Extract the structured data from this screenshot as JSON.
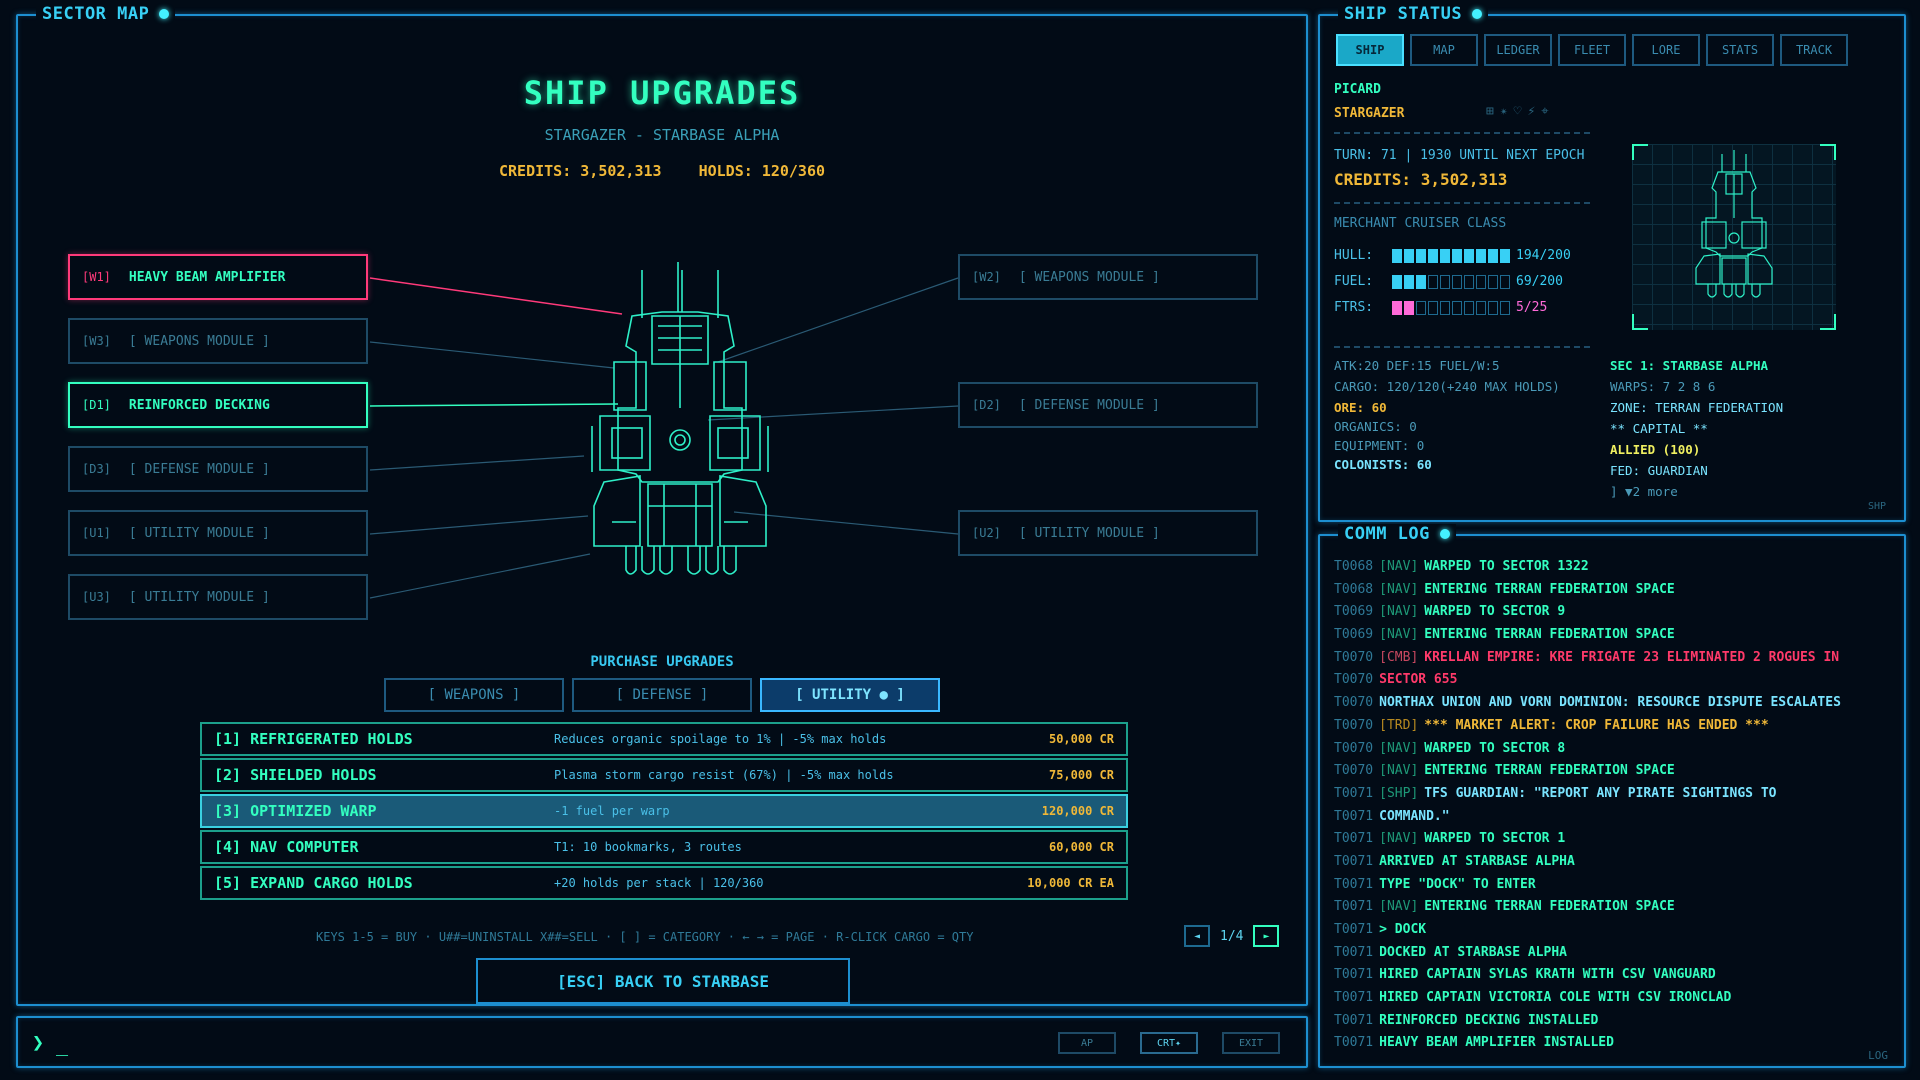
{
  "sector": {
    "frame_title": "SECTOR MAP",
    "title": "SHIP UPGRADES",
    "subtitle": "STARGAZER - STARBASE ALPHA",
    "credits": "CREDITS: 3,502,313",
    "holds": "HOLDS: 120/360",
    "slots": [
      {
        "code": "[W1]",
        "name": "HEAVY BEAM AMPLIFIER",
        "state": "installed-red"
      },
      {
        "code": "[W3]",
        "name": "[ WEAPONS MODULE ]",
        "state": "empty"
      },
      {
        "code": "[D1]",
        "name": "REINFORCED DECKING",
        "state": "installed-green"
      },
      {
        "code": "[D3]",
        "name": "[ DEFENSE MODULE ]",
        "state": "empty"
      },
      {
        "code": "[U1]",
        "name": "[ UTILITY MODULE ]",
        "state": "empty"
      },
      {
        "code": "[U3]",
        "name": "[ UTILITY MODULE ]",
        "state": "empty"
      },
      {
        "code": "[W2]",
        "name": "[ WEAPONS MODULE ]",
        "state": "empty"
      },
      {
        "code": "[D2]",
        "name": "[ DEFENSE MODULE ]",
        "state": "empty"
      },
      {
        "code": "[U2]",
        "name": "[ UTILITY MODULE ]",
        "state": "empty"
      }
    ],
    "purchase_title": "PURCHASE UPGRADES",
    "categories": [
      "[ WEAPONS ]",
      "[ DEFENSE ]",
      "[ UTILITY ● ]"
    ],
    "selected_category": 2,
    "items": [
      {
        "name": "[1] REFRIGERATED HOLDS",
        "desc": "Reduces organic spoilage to 1% | -5% max holds",
        "price": "50,000 CR"
      },
      {
        "name": "[2] SHIELDED HOLDS",
        "desc": "Plasma storm cargo resist (67%) | -5% max holds",
        "price": "75,000 CR"
      },
      {
        "name": "[3] OPTIMIZED WARP",
        "desc": "-1 fuel per warp",
        "price": "120,000 CR"
      },
      {
        "name": "[4] NAV COMPUTER",
        "desc": "T1: 10 bookmarks, 3 routes",
        "price": "60,000 CR"
      },
      {
        "name": "[5] EXPAND CARGO HOLDS",
        "desc": "+20 holds per stack | 120/360",
        "price": "10,000 CR EA"
      }
    ],
    "keys_hint": "KEYS 1-5 = BUY  ·  U##=UNINSTALL X##=SELL  ·  [ ] = CATEGORY  ·  ← → = PAGE  ·  R-CLICK CARGO = QTY",
    "page": "1/4",
    "prev_label": "◄",
    "next_label": "►",
    "back_button": "[ESC] BACK TO STARBASE"
  },
  "cmdbar": {
    "prompt": "❯",
    "cursor": "_",
    "buttons": [
      "AP",
      "CRT✦",
      "EXIT"
    ]
  },
  "status": {
    "frame_title": "SHIP STATUS",
    "tabs": [
      "SHIP",
      "MAP",
      "LEDGER",
      "FLEET",
      "LORE",
      "STATS",
      "TRACK"
    ],
    "selected_tab": 0,
    "pilot": "PICARD",
    "ship": "STARGAZER",
    "icons": "⊞✴♡⚡⌖",
    "turn": "TURN: 71 | 1930 UNTIL NEXT EPOCH",
    "credits": "CREDITS: 3,502,313",
    "ship_class": "MERCHANT CRUISER CLASS",
    "hull": {
      "label": "HULL:",
      "value": "194/200",
      "level": 0.97
    },
    "fuel": {
      "label": "FUEL:",
      "value": "69/200",
      "level": 0.345
    },
    "ftrs": {
      "label": "FTRS:",
      "value": "5/25",
      "level": 0.2
    },
    "combat": "ATK:20 DEF:15 FUEL/W:5",
    "cargo": "CARGO: 120/120(+240 MAX HOLDS)",
    "ore": "ORE: 60",
    "organics": "ORGANICS: 0",
    "equipment": "EQUIPMENT: 0",
    "colonists": "COLONISTS: 60",
    "sector_name": "SEC 1: STARBASE ALPHA",
    "warps": "WARPS: 7 2 8 6",
    "zone": "ZONE: TERRAN FEDERATION",
    "capital": "** CAPITAL **",
    "allied": "ALLIED (100)",
    "fed": "FED: GUARDIAN",
    "more": "] ▼2 more",
    "tag": "SHP"
  },
  "log": {
    "frame_title": "COMM LOG",
    "tag": "LOG",
    "lines": [
      {
        "t": "T0068",
        "tag": "[NAV]",
        "msg": "WARPED TO SECTOR 1322",
        "kind": "nav"
      },
      {
        "t": "T0068",
        "tag": "[NAV]",
        "msg": "ENTERING TERRAN FEDERATION SPACE",
        "kind": "nav"
      },
      {
        "t": "T0069",
        "tag": "[NAV]",
        "msg": "WARPED TO SECTOR 9",
        "kind": "nav"
      },
      {
        "t": "T0069",
        "tag": "[NAV]",
        "msg": "ENTERING TERRAN FEDERATION SPACE",
        "kind": "nav"
      },
      {
        "t": "T0070",
        "tag": "[CMB]",
        "msg": "KRELLAN EMPIRE: KRE FRIGATE 23 ELIMINATED 2 ROGUES IN",
        "kind": "cmb"
      },
      {
        "t": "T0070",
        "tag": "",
        "msg": "SECTOR 655",
        "kind": "cmb"
      },
      {
        "t": "T0070",
        "tag": "",
        "msg": "NORTHAX UNION AND VORN DOMINION: RESOURCE DISPUTE ESCALATES",
        "kind": "cyan"
      },
      {
        "t": "T0070",
        "tag": "[TRD]",
        "msg": "*** MARKET ALERT: CROP FAILURE HAS ENDED ***",
        "kind": "trd"
      },
      {
        "t": "T0070",
        "tag": "[NAV]",
        "msg": "WARPED TO SECTOR 8",
        "kind": "nav"
      },
      {
        "t": "T0070",
        "tag": "[NAV]",
        "msg": "ENTERING TERRAN FEDERATION SPACE",
        "kind": "nav"
      },
      {
        "t": "T0071",
        "tag": "[SHP]",
        "msg": "TFS GUARDIAN: \"REPORT ANY PIRATE SIGHTINGS TO",
        "kind": "shp"
      },
      {
        "t": "T0071",
        "tag": "",
        "msg": "COMMAND.\"",
        "kind": "shp"
      },
      {
        "t": "T0071",
        "tag": "[NAV]",
        "msg": "WARPED TO SECTOR 1",
        "kind": "nav"
      },
      {
        "t": "T0071",
        "tag": "",
        "msg": "ARRIVED AT STARBASE ALPHA",
        "kind": "nav"
      },
      {
        "t": "T0071",
        "tag": "",
        "msg": "TYPE \"DOCK\" TO ENTER",
        "kind": "nav"
      },
      {
        "t": "T0071",
        "tag": "[NAV]",
        "msg": "ENTERING TERRAN FEDERATION SPACE",
        "kind": "nav"
      },
      {
        "t": "T0071",
        "tag": "",
        "msg": "> DOCK",
        "kind": "nav"
      },
      {
        "t": "T0071",
        "tag": "",
        "msg": "DOCKED AT STARBASE ALPHA",
        "kind": "nav"
      },
      {
        "t": "T0071",
        "tag": "",
        "msg": "HIRED CAPTAIN SYLAS KRATH WITH CSV VANGUARD",
        "kind": "nav"
      },
      {
        "t": "T0071",
        "tag": "",
        "msg": "HIRED CAPTAIN VICTORIA COLE WITH CSV IRONCLAD",
        "kind": "nav"
      },
      {
        "t": "T0071",
        "tag": "",
        "msg": "REINFORCED DECKING INSTALLED",
        "kind": "nav"
      },
      {
        "t": "T0071",
        "tag": "",
        "msg": "HEAVY BEAM AMPLIFIER INSTALLED",
        "kind": "nav"
      }
    ]
  },
  "colors": {
    "accent": "#1d8fd0",
    "green": "#33ffc0",
    "gold": "#f0b838",
    "red": "#ff3a7a",
    "pink": "#ff6ad8"
  }
}
